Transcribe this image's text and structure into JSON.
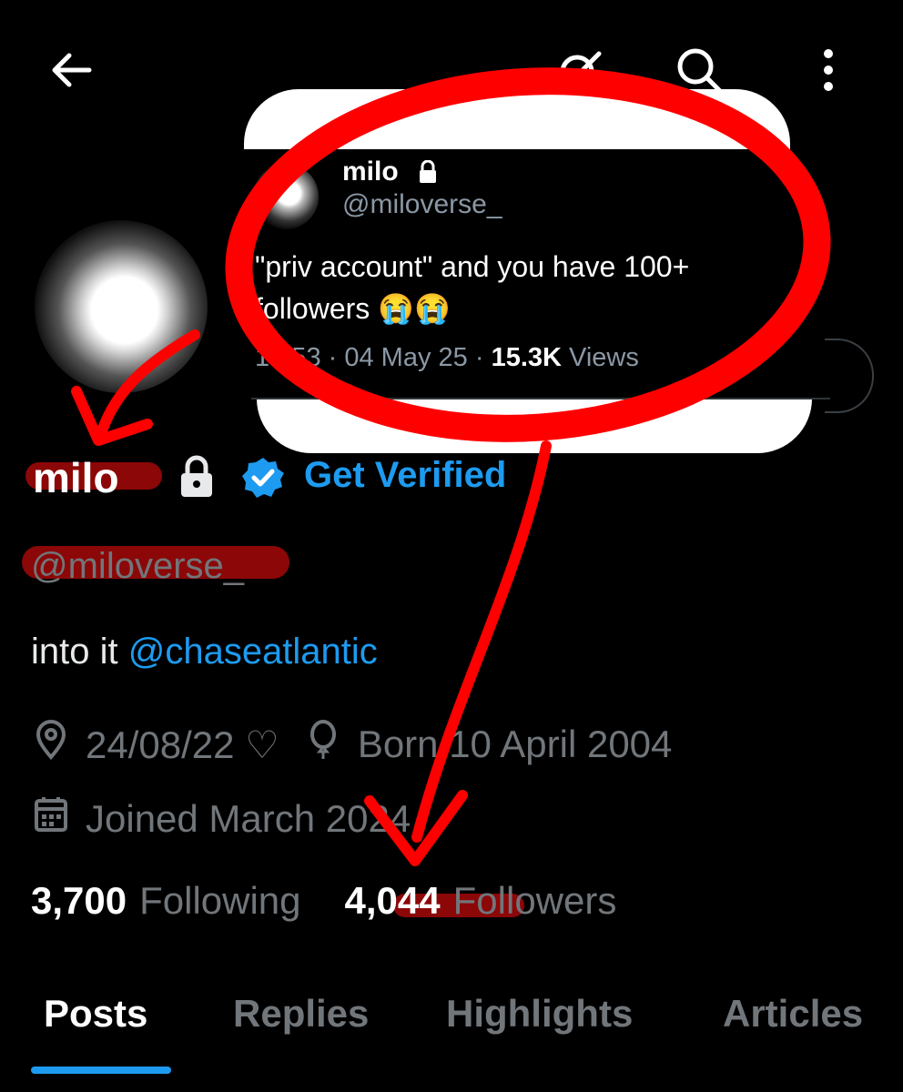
{
  "topbar": {
    "partial_title": "c"
  },
  "embed": {
    "name": "milo",
    "handle": "@miloverse_",
    "text": "\"priv account\" and you have 100+ followers 😭😭",
    "time": "10:53",
    "date": "04 May 25",
    "views_value": "15.3K",
    "views_label": "Views"
  },
  "profile": {
    "display_name": "milo",
    "get_verified": "Get Verified",
    "handle": "@miloverse_",
    "bio_prefix": "into it ",
    "bio_mention": "@chaseatlantic",
    "location": "24/08/22 ♡",
    "birthday": "Born 10 April 2004",
    "joined": "Joined March 2024",
    "following_count": "3,700",
    "following_label": "Following",
    "followers_count": "4,044",
    "followers_label": "Followers"
  },
  "tabs": [
    {
      "label": "Posts"
    },
    {
      "label": "Replies"
    },
    {
      "label": "Highlights"
    },
    {
      "label": "Articles"
    }
  ],
  "colors": {
    "accent": "#1d9bf0",
    "annotation": "#ff0000",
    "muted": "#71767b"
  }
}
